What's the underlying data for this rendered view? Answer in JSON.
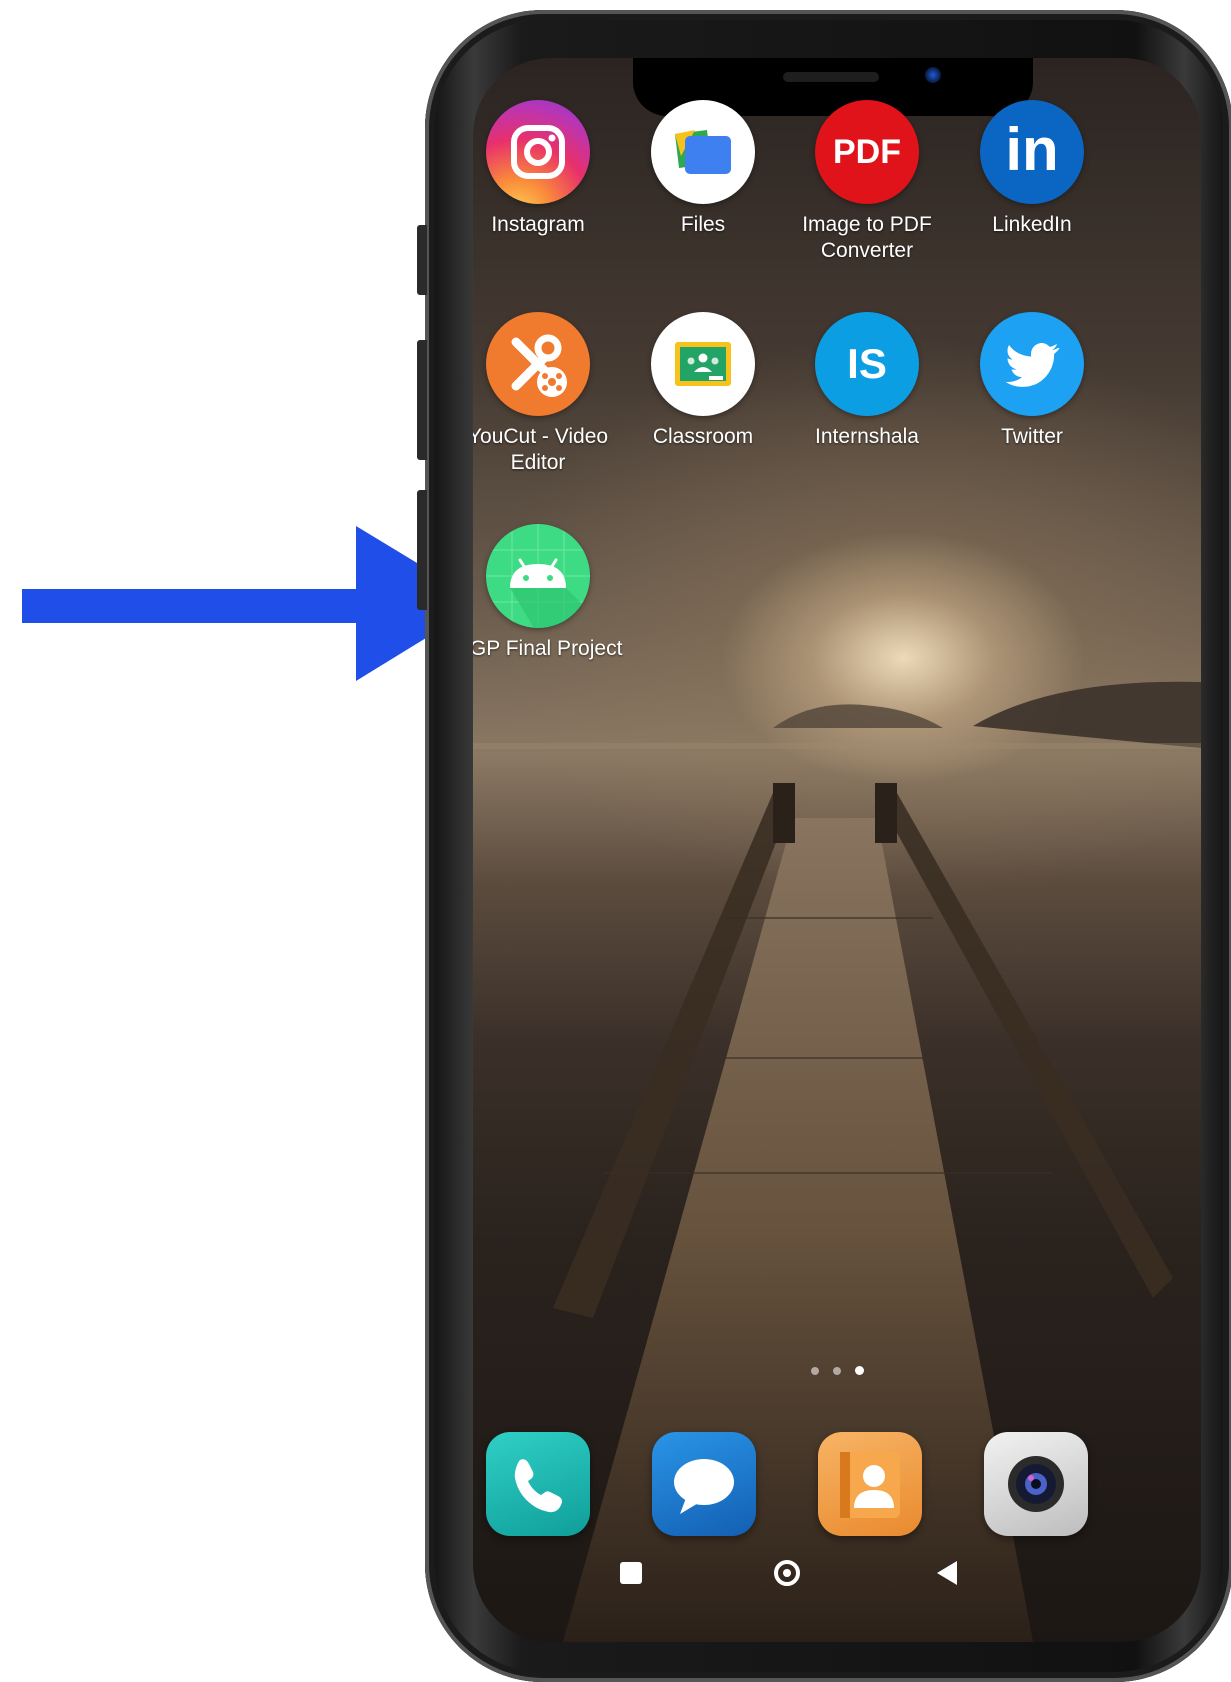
{
  "home_screen": {
    "apps": [
      {
        "label": "Instagram",
        "icon": "instagram-icon"
      },
      {
        "label": "Files",
        "icon": "files-icon"
      },
      {
        "label": "Image to PDF Converter",
        "icon": "pdf-icon",
        "icon_text": "PDF"
      },
      {
        "label": "LinkedIn",
        "icon": "linkedin-icon",
        "icon_text": "in"
      },
      {
        "label": "YouCut - Video Editor",
        "icon": "scissors-icon"
      },
      {
        "label": "Classroom",
        "icon": "classroom-icon"
      },
      {
        "label": "Internshala",
        "icon": "internshala-icon",
        "icon_text": "IS"
      },
      {
        "label": "Twitter",
        "icon": "bird-icon"
      },
      {
        "label": "GGP Final Project",
        "icon": "android-icon"
      }
    ],
    "page_indicator": {
      "pages": 3,
      "current": 3
    },
    "dock": [
      {
        "name": "phone",
        "icon": "phone-icon",
        "color": "#1bb5b0"
      },
      {
        "name": "messages",
        "icon": "chat-bubble-icon",
        "color": "#1c7fd0"
      },
      {
        "name": "contacts",
        "icon": "contact-icon",
        "color": "#f2a04a"
      },
      {
        "name": "camera",
        "icon": "camera-icon",
        "color": "#d8d8d8"
      }
    ],
    "navigation": [
      {
        "name": "recents",
        "icon": "square-icon"
      },
      {
        "name": "home",
        "icon": "circle-icon"
      },
      {
        "name": "back",
        "icon": "triangle-back-icon"
      }
    ]
  },
  "annotation": {
    "icon": "arrow-right-icon",
    "color": "#1f4fe8"
  }
}
